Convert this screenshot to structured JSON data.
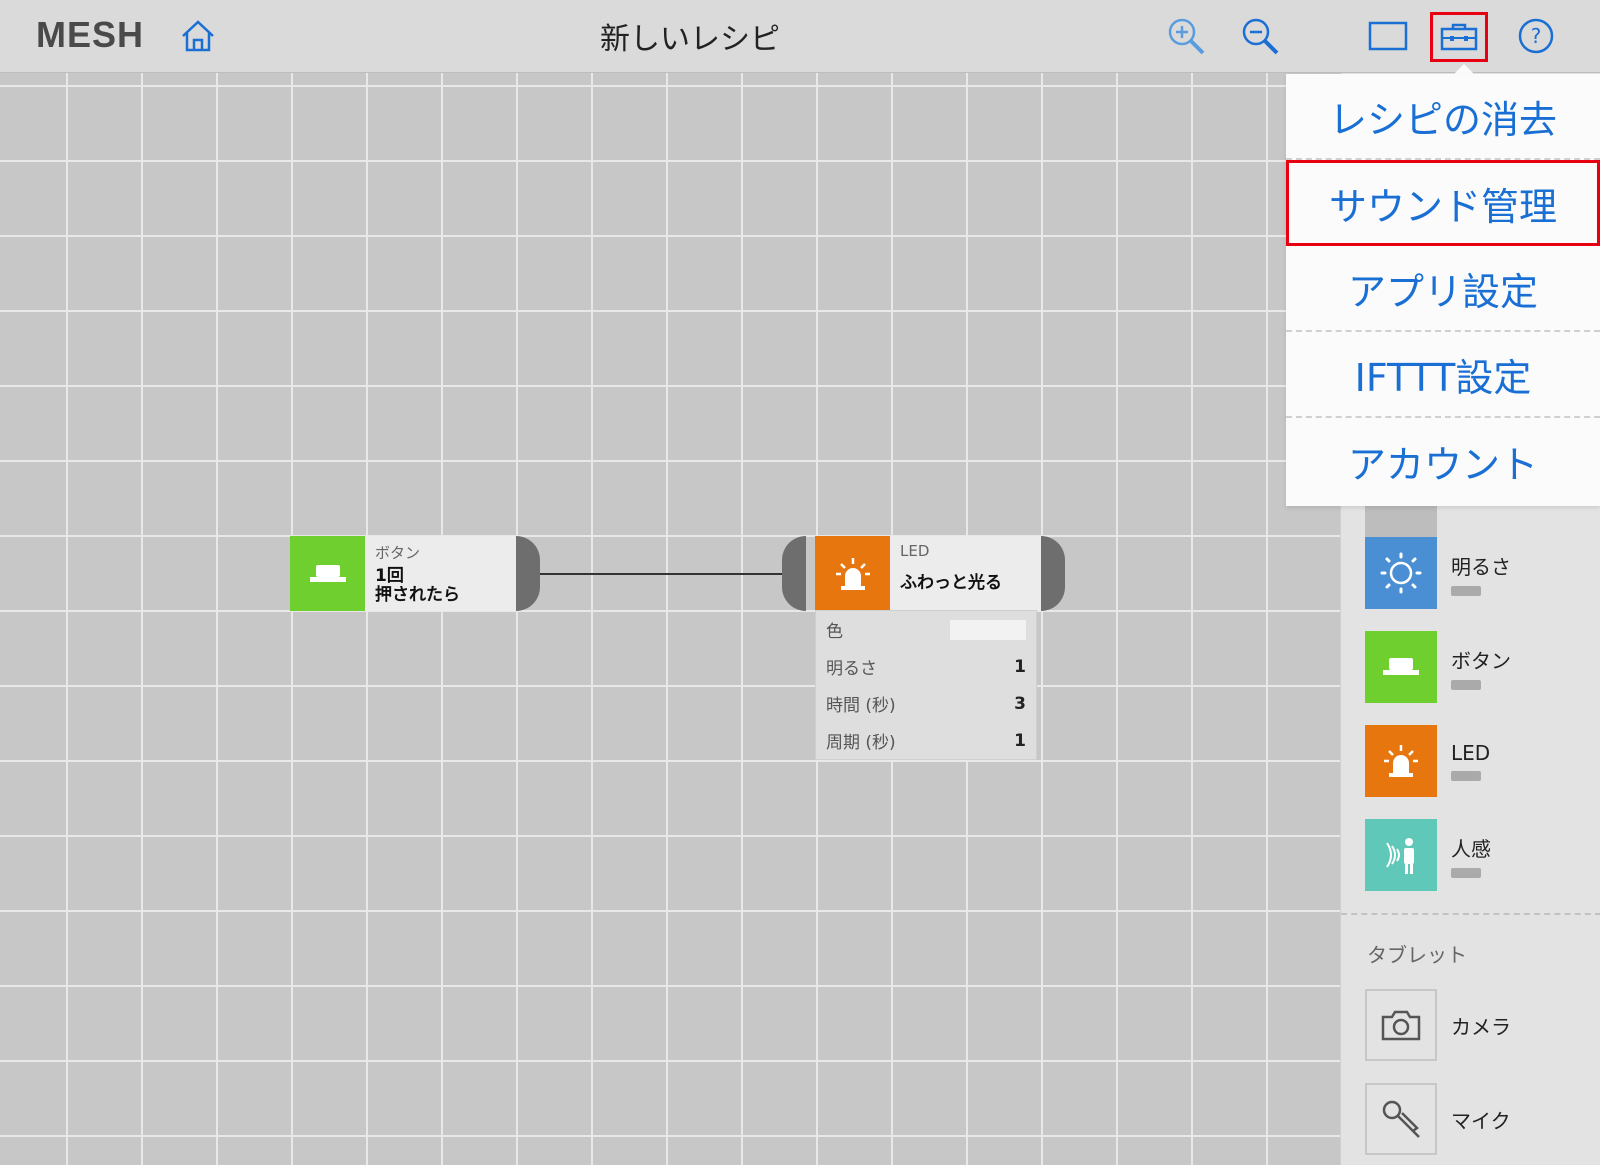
{
  "header": {
    "logo": "MESH",
    "title": "新しいレシピ",
    "icons": [
      "home-icon",
      "zoom-in-icon",
      "zoom-out-icon",
      "frame-icon",
      "toolbox-icon",
      "help-icon"
    ]
  },
  "canvas": {
    "button_block": {
      "category": "ボタン",
      "action_line1": "1回",
      "action_line2": "押されたら",
      "color": "#6ecf2f"
    },
    "led_block": {
      "category": "LED",
      "action": "ふわっと光る",
      "color": "#e8760e",
      "props": [
        {
          "label": "色",
          "value": ""
        },
        {
          "label": "明るさ",
          "value": "1"
        },
        {
          "label": "時間 (秒)",
          "value": "3"
        },
        {
          "label": "周期 (秒)",
          "value": "1"
        }
      ]
    }
  },
  "menu": {
    "items": [
      "レシピの消去",
      "サウンド管理",
      "アプリ設定",
      "IFTTT設定",
      "アカウント"
    ],
    "highlighted": "サウンド管理"
  },
  "panel": {
    "tags": [
      {
        "name": "明るさ",
        "color": "#4a8fd4",
        "icon": "brightness-icon"
      },
      {
        "name": "ボタン",
        "color": "#6ecf2f",
        "icon": "button-icon"
      },
      {
        "name": "LED",
        "color": "#e8760e",
        "icon": "led-icon"
      },
      {
        "name": "人感",
        "color": "#5fc8b8",
        "icon": "motion-icon"
      }
    ],
    "tablet_label": "タブレット",
    "tablet": [
      {
        "name": "カメラ",
        "icon": "camera-icon"
      },
      {
        "name": "マイク",
        "icon": "microphone-icon"
      }
    ]
  }
}
